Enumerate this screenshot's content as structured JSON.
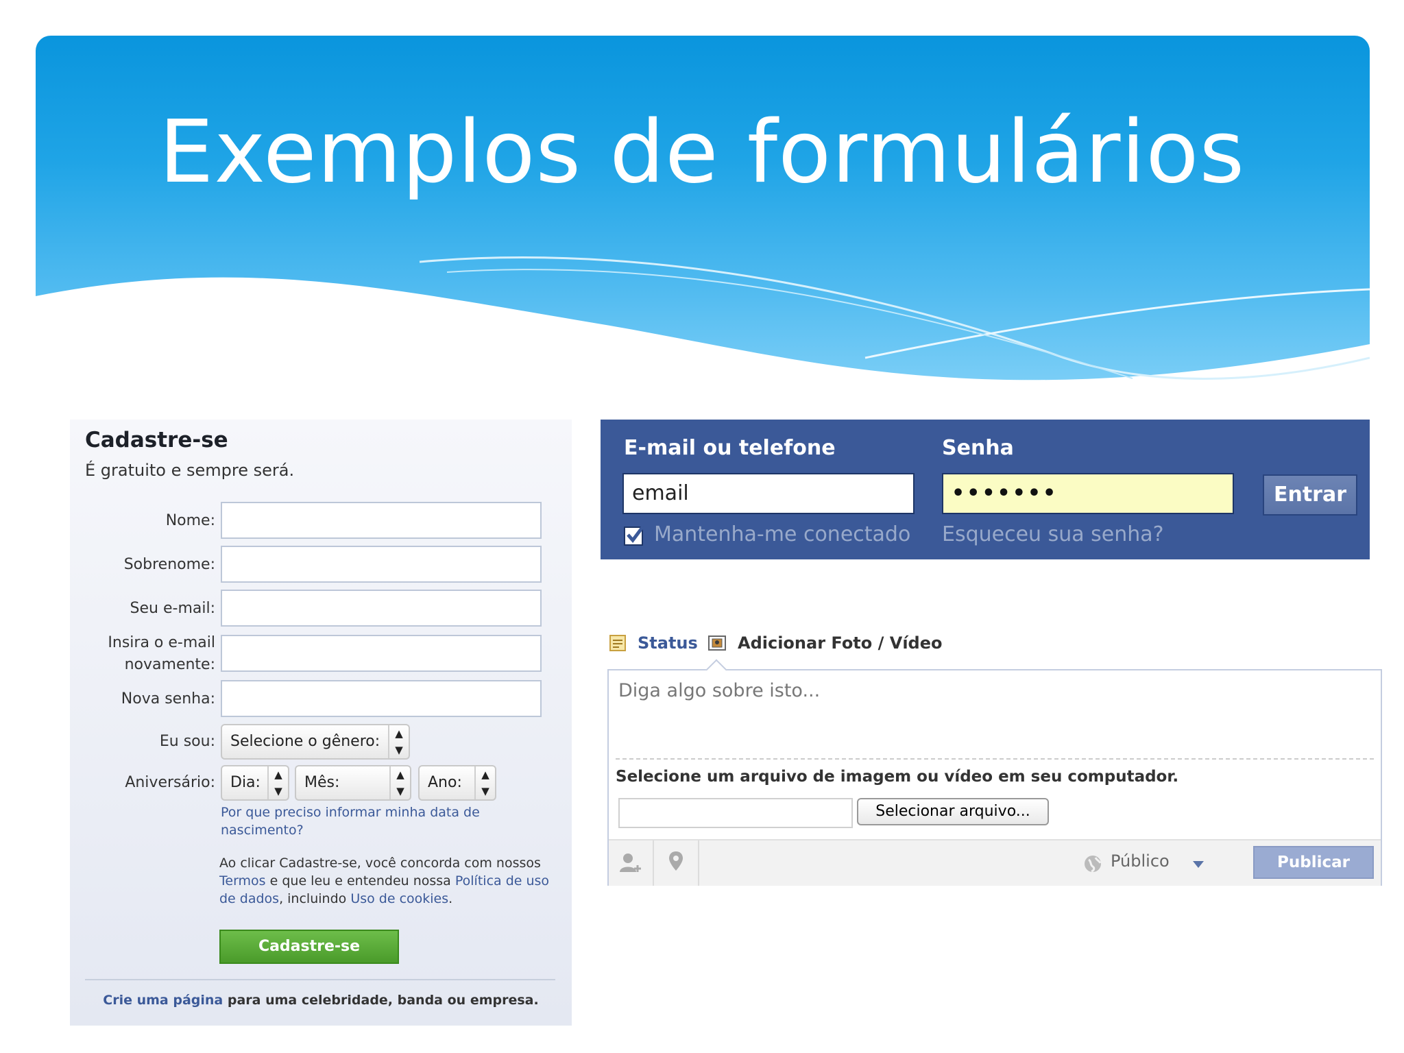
{
  "slide": {
    "title": "Exemplos de formulários"
  },
  "signup": {
    "heading": "Cadastre-se",
    "subheading": "É gratuito e sempre será.",
    "fields": {
      "first_name": "Nome:",
      "last_name": "Sobrenome:",
      "email": "Seu e-mail:",
      "email_confirm_line1": "Insira o e-mail",
      "email_confirm_line2": "novamente:",
      "password": "Nova senha:"
    },
    "gender_label": "Eu sou:",
    "gender_select": "Selecione o gênero:",
    "birthday_label": "Aniversário:",
    "day_select": "Dia:",
    "month_select": "Mês:",
    "year_select": "Ano:",
    "why_birthday": "Por que preciso informar minha data de nascimento?",
    "terms": {
      "text1": "Ao clicar Cadastre-se, você concorda com nossos",
      "terms_link": "Termos",
      "text2": "e que leu e entendeu nossa",
      "policy_link": "Política de uso de dados",
      "text3": ", incluindo",
      "cookies_link": "Uso de cookies",
      "text4": "."
    },
    "submit_button": "Cadastre-se",
    "footer": {
      "link": "Crie uma página",
      "text": "para uma celebridade, banda ou empresa."
    }
  },
  "login": {
    "email_label": "E-mail ou telefone",
    "email_value": "email",
    "password_label": "Senha",
    "password_value": "•••••••",
    "login_button": "Entrar",
    "keep_logged": "Mantenha-me conectado",
    "forgot_password": "Esqueceu sua senha?",
    "colors": {
      "bar": "#3b5998",
      "password_highlight": "#fbfcc4"
    }
  },
  "composer": {
    "tabs": {
      "status": "Status",
      "add_photo": "Adicionar Foto / Vídeo"
    },
    "placeholder": "Diga algo sobre isto...",
    "pick_file_text": "Selecione um arquivo de imagem ou vídeo em seu computador.",
    "file_button": "Selecionar arquivo...",
    "audience": "Público",
    "publish_button": "Publicar",
    "icons": [
      "status-note-icon",
      "photo-icon",
      "tag-person-icon",
      "location-pin-icon",
      "globe-icon",
      "chevron-down-icon"
    ]
  }
}
